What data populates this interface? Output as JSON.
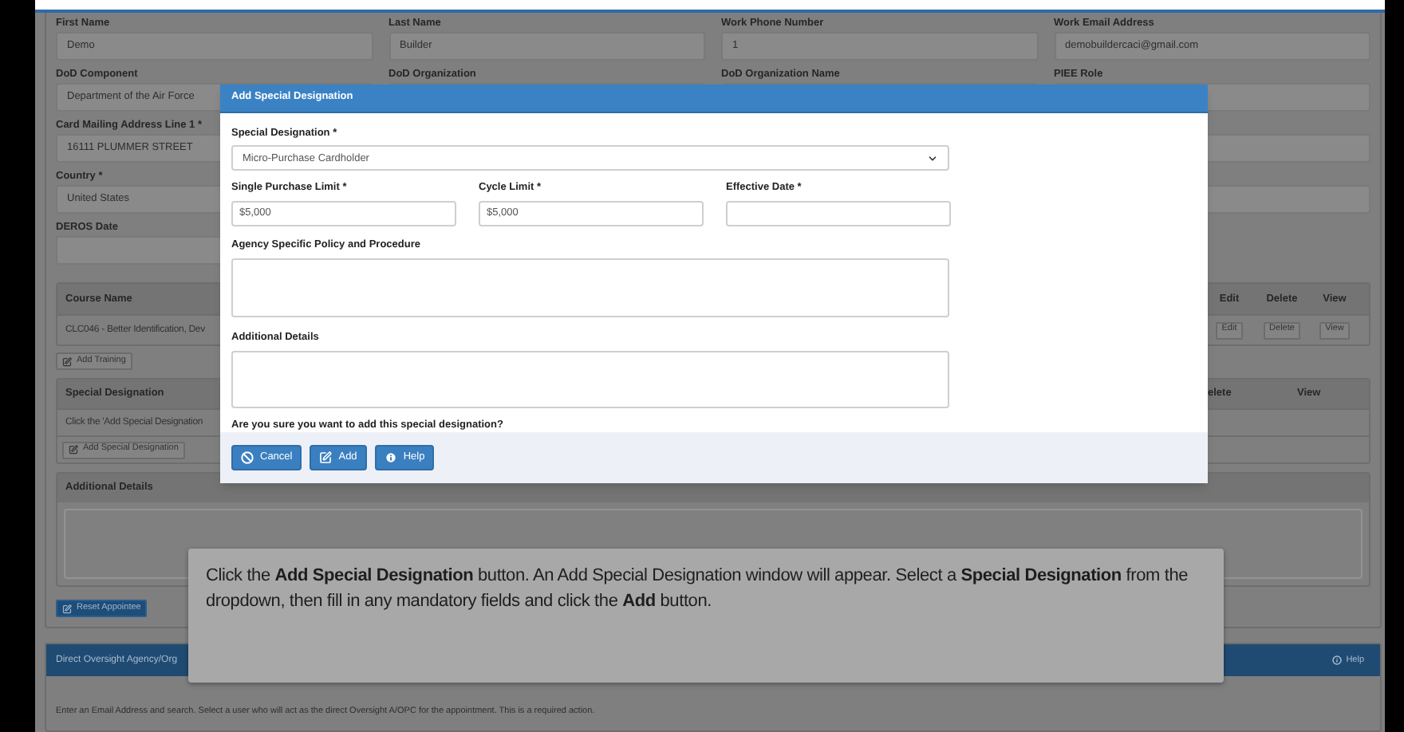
{
  "form_rows": [
    [
      {
        "label": "First Name",
        "value": "Demo"
      },
      {
        "label": "Last Name",
        "value": "Builder"
      },
      {
        "label": "Work Phone Number",
        "value": "1"
      },
      {
        "label": "Work Email Address",
        "value": "demobuildercaci@gmail.com"
      }
    ],
    [
      {
        "label": "DoD Component",
        "value": "Department of the Air Force"
      },
      {
        "label": "DoD Organization"
      },
      {
        "label": "DoD Organization Name"
      },
      {
        "label": "PIEE Role"
      }
    ],
    [
      {
        "label": "Card Mailing Address Line 1 *",
        "value": "16111 PLUMMER STREET"
      },
      null,
      null,
      {}
    ],
    [
      {
        "label": "Country *",
        "value": "United States"
      },
      null,
      null,
      {}
    ],
    [
      {
        "label": "DEROS Date"
      }
    ]
  ],
  "training_table": {
    "columns": [
      "Course Name",
      "Edit",
      "Delete",
      "View"
    ],
    "rows": [
      {
        "course": "CLC046 - Better Identification, Dev",
        "actions": [
          "Edit",
          "Delete",
          "View"
        ]
      }
    ],
    "add_button": "Add Training"
  },
  "special_designation_table": {
    "columns": [
      "Special Designation",
      "elete",
      "View"
    ],
    "rows": [
      "Click the 'Add Special Designation"
    ],
    "add_button": "Add Special Designation"
  },
  "additional_details": {
    "title": "Additional Details"
  },
  "reset_button": "Reset Appointee",
  "oversight_panel": {
    "title": "Direct Oversight Agency/Org",
    "help": "Help",
    "text": "Enter an Email Address and search. Select a user who will act as the direct Oversight A/OPC for the appointment. This is a required action."
  },
  "modal": {
    "title": "Add Special Designation",
    "designation": {
      "label": "Special Designation *",
      "value": "Micro-Purchase Cardholder"
    },
    "limits": [
      {
        "label": "Single Purchase Limit *",
        "value": "$5,000"
      },
      {
        "label": "Cycle Limit *",
        "value": "$5,000"
      },
      {
        "label": "Effective Date *"
      }
    ],
    "policy": {
      "label": "Agency Specific Policy and Procedure"
    },
    "details": {
      "label": "Additional Details"
    },
    "question": "Are you sure you want to add this special designation?",
    "buttons": [
      {
        "label": "Cancel",
        "kind": "cancel"
      },
      {
        "label": "Add",
        "kind": "add"
      },
      {
        "label": "Help",
        "kind": "help"
      }
    ]
  },
  "callout": {
    "text": "Click the **Add Special Designation** button. An Add Special Designation window will appear.  Select a **Special Designation** from the dropdown, then fill in any mandatory fields and click the **Add** button."
  }
}
